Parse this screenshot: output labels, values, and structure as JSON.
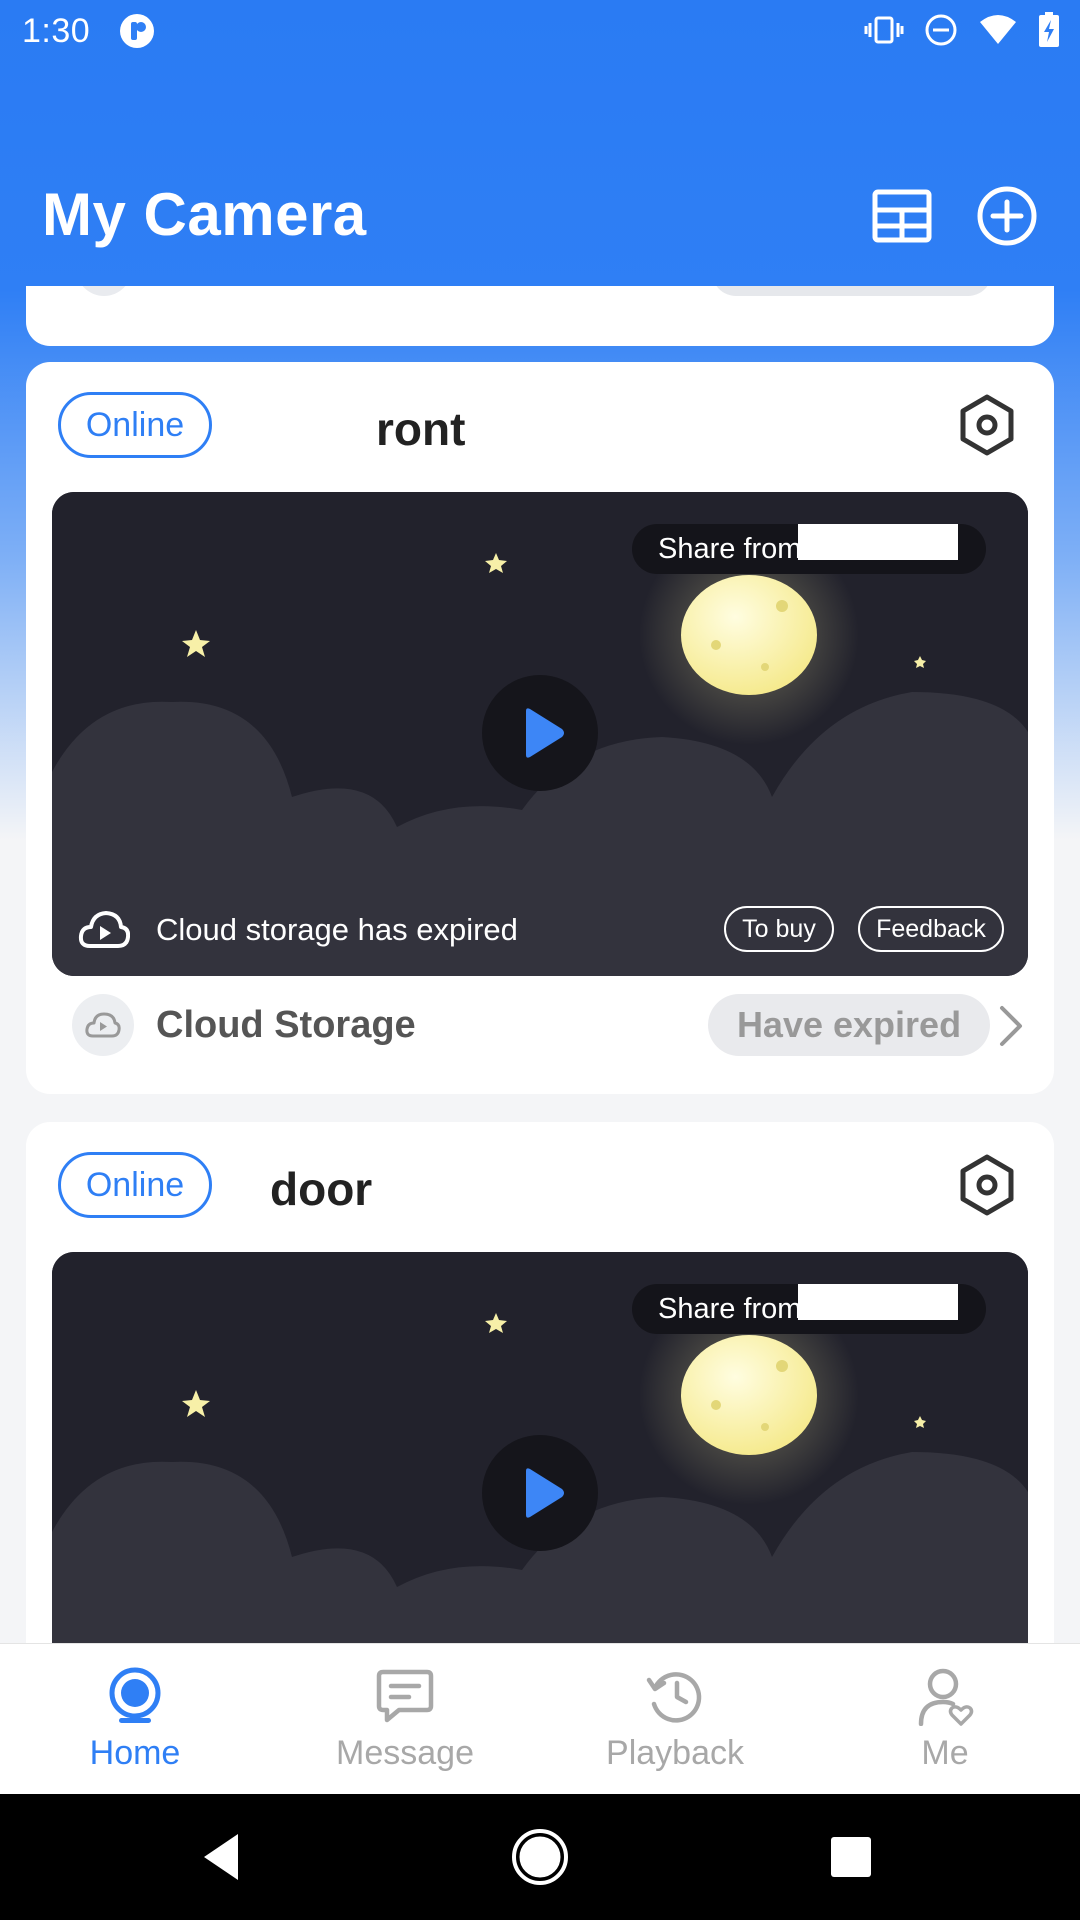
{
  "status_bar": {
    "time": "1:30",
    "icons": [
      "app-notification-icon",
      "vibrate-icon",
      "do-not-disturb-icon",
      "wifi-icon",
      "battery-charging-icon"
    ]
  },
  "header": {
    "title": "My Camera",
    "buttons": [
      "grid-view-icon",
      "add-device-icon"
    ]
  },
  "cameras": [
    {
      "status": "Online",
      "name": "ront",
      "share_text": "Share from",
      "cloud_notice": "Cloud storage has expired",
      "buy_label": "To buy",
      "feedback_label": "Feedback",
      "cloud_storage_label": "Cloud Storage",
      "cloud_storage_status": "Have expired"
    },
    {
      "status": "Online",
      "name": "door",
      "share_text": "Share from"
    }
  ],
  "bottom_nav": {
    "items": [
      {
        "label": "Home",
        "icon": "home-camera-icon",
        "active": true
      },
      {
        "label": "Message",
        "icon": "message-icon",
        "active": false
      },
      {
        "label": "Playback",
        "icon": "playback-history-icon",
        "active": false
      },
      {
        "label": "Me",
        "icon": "profile-icon",
        "active": false
      }
    ]
  },
  "system_nav": [
    "back-icon",
    "home-icon",
    "recents-icon"
  ],
  "colors": {
    "accent": "#2f7ff5",
    "header_bg": "#2a7bf3",
    "preview_bg": "#22222c",
    "inactive": "#a8a8a8"
  }
}
